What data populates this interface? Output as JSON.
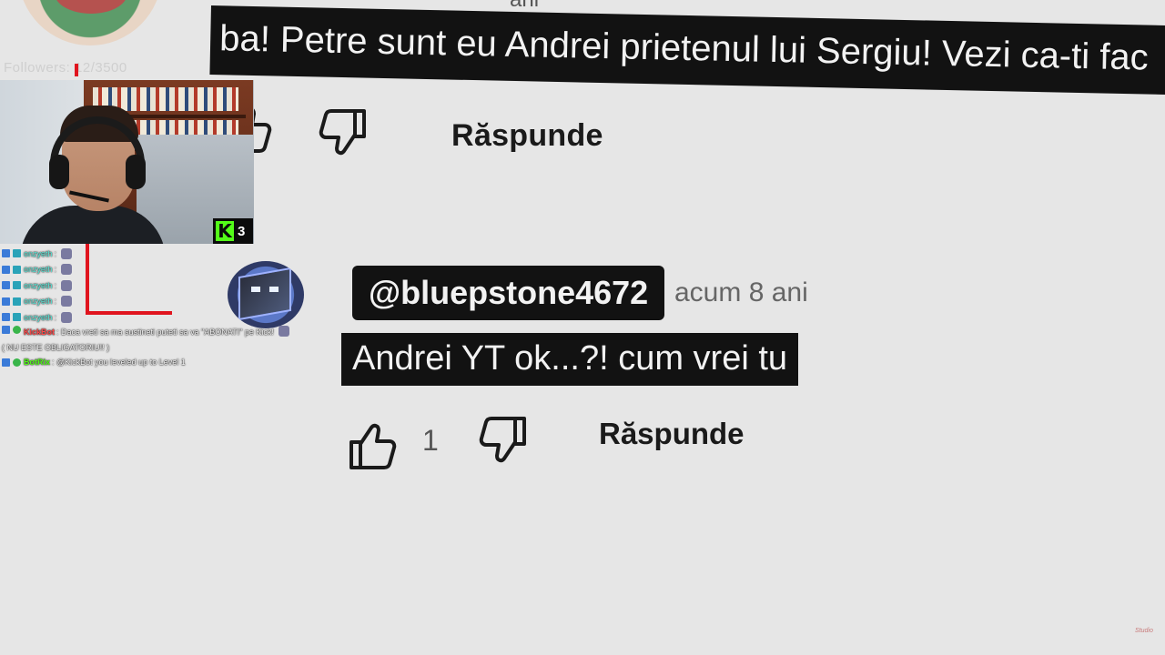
{
  "first_comment": {
    "time_partial": "ani",
    "text": "ba! Petre sunt eu Andrei prietenul lui Sergiu! Vezi ca-ti fac",
    "reply_label": "Răspunde"
  },
  "followers_overlay": "Followers: 12/3500",
  "webcam": {
    "kick_count": "3"
  },
  "chat": [
    {
      "user": "onzyeth",
      "sep": ":"
    },
    {
      "user": "onzyeth",
      "sep": ":"
    },
    {
      "user": "onzyeth",
      "sep": ":"
    },
    {
      "user": "onzyeth",
      "sep": ":"
    },
    {
      "user": "onzyeth",
      "sep": ":"
    }
  ],
  "chat_kickbot": {
    "user": "KickBot",
    "message": ": Daca vreti sa ma sustineti puteti sa va \"ABONATI\" pe Kick!",
    "message_cont": "( NU ESTE OBLIGATORIU!! )"
  },
  "chat_botrix": {
    "user": "BotRix",
    "message": ": @KickBot you leveled up to Level 1"
  },
  "second_comment": {
    "handle": "@bluepstone4672",
    "time": "acum 8 ani",
    "text": "Andrei YT ok...?! cum vrei tu",
    "like_count": "1",
    "reply_label": "Răspunde"
  },
  "watermark": "Studio",
  "colors": {
    "kick_green": "#53fc18",
    "banner_bg": "#121212",
    "page_bg": "#e6e6e6",
    "accent_red": "#e0141e"
  }
}
